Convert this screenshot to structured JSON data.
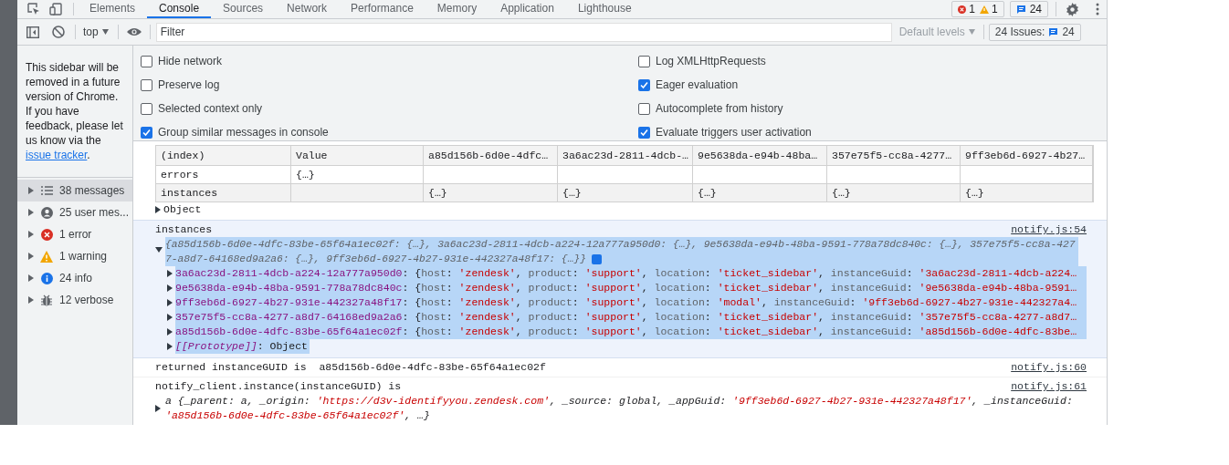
{
  "tabs": [
    {
      "label": "Elements",
      "selected": false
    },
    {
      "label": "Console",
      "selected": true
    },
    {
      "label": "Sources",
      "selected": false
    },
    {
      "label": "Network",
      "selected": false
    },
    {
      "label": "Performance",
      "selected": false
    },
    {
      "label": "Memory",
      "selected": false
    },
    {
      "label": "Application",
      "selected": false
    },
    {
      "label": "Lighthouse",
      "selected": false
    }
  ],
  "counters": {
    "errors": "1",
    "warnings": "1",
    "issues": "24"
  },
  "toolbar": {
    "context": "top",
    "filter_placeholder": "Filter",
    "levels": "Default levels",
    "issues_label": "24 Issues:",
    "issues_count": "24"
  },
  "settings": {
    "left": [
      {
        "label": "Hide network",
        "checked": false
      },
      {
        "label": "Preserve log",
        "checked": false
      },
      {
        "label": "Selected context only",
        "checked": false
      },
      {
        "label": "Group similar messages in console",
        "checked": true
      }
    ],
    "right": [
      {
        "label": "Log XMLHttpRequests",
        "checked": false
      },
      {
        "label": "Eager evaluation",
        "checked": true
      },
      {
        "label": "Autocomplete from history",
        "checked": false
      },
      {
        "label": "Evaluate triggers user activation",
        "checked": true
      }
    ]
  },
  "sidebar": {
    "note": "This sidebar will be removed in a future version of Chrome. If you have feedback, please let us know via the",
    "link": "issue tracker",
    "note_end": ".",
    "items": [
      {
        "kind": "messages",
        "label": "38 messages",
        "selected": true
      },
      {
        "kind": "user",
        "label": "25 user mes...",
        "selected": false
      },
      {
        "kind": "error",
        "label": "1 error",
        "selected": false
      },
      {
        "kind": "warning",
        "label": "1 warning",
        "selected": false
      },
      {
        "kind": "info",
        "label": "24 info",
        "selected": false
      },
      {
        "kind": "verbose",
        "label": "12 verbose",
        "selected": false
      }
    ]
  },
  "table": {
    "columns": [
      "(index)",
      "Value",
      "a85d156b-6d0e-4dfc…",
      "3a6ac23d-2811-4dcb-…",
      "9e5638da-e94b-48ba…",
      "357e75f5-cc8a-4277…",
      "9ff3eb6d-6927-4b27…"
    ],
    "rows": [
      [
        "errors",
        "{…}",
        "",
        "",
        "",
        "",
        ""
      ],
      [
        "instances",
        "",
        "{…}",
        "{…}",
        "{…}",
        "{…}",
        "{…}"
      ]
    ],
    "footer": "Object"
  },
  "instances_message": {
    "title": "instances",
    "source": "notify.js:54",
    "expanded": true,
    "summary": "{a85d156b-6d0e-4dfc-83be-65f64a1ec02f: {…}, 3a6ac23d-2811-4dcb-a224-12a777a950d0: {…}, 9e5638da-e94b-48ba-9591-778a78dc840c: {…}, 357e75f5-cc8a-4277-a8d7-64168ed9a2a6: {…}, 9ff3eb6d-6927-4b27-931e-442327a48f17: {…}}",
    "entries": [
      [
        {
          "kind": "key",
          "text": "3a6ac23d-2811-4dcb-a224-12a777a950d0"
        },
        {
          "kind": "punct",
          "text": ": {"
        },
        {
          "kind": "name",
          "text": "host"
        },
        {
          "kind": "punct",
          "text": ": "
        },
        {
          "kind": "string",
          "text": "'zendesk'"
        },
        {
          "kind": "punct",
          "text": ", "
        },
        {
          "kind": "name",
          "text": "product"
        },
        {
          "kind": "punct",
          "text": ": "
        },
        {
          "kind": "string",
          "text": "'support'"
        },
        {
          "kind": "punct",
          "text": ", "
        },
        {
          "kind": "name",
          "text": "location"
        },
        {
          "kind": "punct",
          "text": ": "
        },
        {
          "kind": "string",
          "text": "'ticket_sidebar'"
        },
        {
          "kind": "punct",
          "text": ", "
        },
        {
          "kind": "name",
          "text": "instanceGuid"
        },
        {
          "kind": "punct",
          "text": ": "
        },
        {
          "kind": "string",
          "text": "'3a6ac23d-2811-4dcb-a224…"
        }
      ],
      [
        {
          "kind": "key",
          "text": "9e5638da-e94b-48ba-9591-778a78dc840c"
        },
        {
          "kind": "punct",
          "text": ": {"
        },
        {
          "kind": "name",
          "text": "host"
        },
        {
          "kind": "punct",
          "text": ": "
        },
        {
          "kind": "string",
          "text": "'zendesk'"
        },
        {
          "kind": "punct",
          "text": ", "
        },
        {
          "kind": "name",
          "text": "product"
        },
        {
          "kind": "punct",
          "text": ": "
        },
        {
          "kind": "string",
          "text": "'support'"
        },
        {
          "kind": "punct",
          "text": ", "
        },
        {
          "kind": "name",
          "text": "location"
        },
        {
          "kind": "punct",
          "text": ": "
        },
        {
          "kind": "string",
          "text": "'ticket_sidebar'"
        },
        {
          "kind": "punct",
          "text": ", "
        },
        {
          "kind": "name",
          "text": "instanceGuid"
        },
        {
          "kind": "punct",
          "text": ": "
        },
        {
          "kind": "string",
          "text": "'9e5638da-e94b-48ba-9591…"
        }
      ],
      [
        {
          "kind": "key",
          "text": "9ff3eb6d-6927-4b27-931e-442327a48f17"
        },
        {
          "kind": "punct",
          "text": ": {"
        },
        {
          "kind": "name",
          "text": "host"
        },
        {
          "kind": "punct",
          "text": ": "
        },
        {
          "kind": "string",
          "text": "'zendesk'"
        },
        {
          "kind": "punct",
          "text": ", "
        },
        {
          "kind": "name",
          "text": "product"
        },
        {
          "kind": "punct",
          "text": ": "
        },
        {
          "kind": "string",
          "text": "'support'"
        },
        {
          "kind": "punct",
          "text": ", "
        },
        {
          "kind": "name",
          "text": "location"
        },
        {
          "kind": "punct",
          "text": ": "
        },
        {
          "kind": "string",
          "text": "'modal'"
        },
        {
          "kind": "punct",
          "text": ", "
        },
        {
          "kind": "name",
          "text": "instanceGuid"
        },
        {
          "kind": "punct",
          "text": ": "
        },
        {
          "kind": "string",
          "text": "'9ff3eb6d-6927-4b27-931e-442327a4…"
        }
      ],
      [
        {
          "kind": "key",
          "text": "357e75f5-cc8a-4277-a8d7-64168ed9a2a6"
        },
        {
          "kind": "punct",
          "text": ": {"
        },
        {
          "kind": "name",
          "text": "host"
        },
        {
          "kind": "punct",
          "text": ": "
        },
        {
          "kind": "string",
          "text": "'zendesk'"
        },
        {
          "kind": "punct",
          "text": ", "
        },
        {
          "kind": "name",
          "text": "product"
        },
        {
          "kind": "punct",
          "text": ": "
        },
        {
          "kind": "string",
          "text": "'support'"
        },
        {
          "kind": "punct",
          "text": ", "
        },
        {
          "kind": "name",
          "text": "location"
        },
        {
          "kind": "punct",
          "text": ": "
        },
        {
          "kind": "string",
          "text": "'ticket_sidebar'"
        },
        {
          "kind": "punct",
          "text": ", "
        },
        {
          "kind": "name",
          "text": "instanceGuid"
        },
        {
          "kind": "punct",
          "text": ": "
        },
        {
          "kind": "string",
          "text": "'357e75f5-cc8a-4277-a8d7…"
        }
      ],
      [
        {
          "kind": "key",
          "text": "a85d156b-6d0e-4dfc-83be-65f64a1ec02f"
        },
        {
          "kind": "punct",
          "text": ": {"
        },
        {
          "kind": "name",
          "text": "host"
        },
        {
          "kind": "punct",
          "text": ": "
        },
        {
          "kind": "string",
          "text": "'zendesk'"
        },
        {
          "kind": "punct",
          "text": ", "
        },
        {
          "kind": "name",
          "text": "product"
        },
        {
          "kind": "punct",
          "text": ": "
        },
        {
          "kind": "string",
          "text": "'support'"
        },
        {
          "kind": "punct",
          "text": ", "
        },
        {
          "kind": "name",
          "text": "location"
        },
        {
          "kind": "punct",
          "text": ": "
        },
        {
          "kind": "string",
          "text": "'ticket_sidebar'"
        },
        {
          "kind": "punct",
          "text": ", "
        },
        {
          "kind": "name",
          "text": "instanceGuid"
        },
        {
          "kind": "punct",
          "text": ": "
        },
        {
          "kind": "string",
          "text": "'a85d156b-6d0e-4dfc-83be…"
        }
      ],
      [
        {
          "kind": "meta",
          "text": "[[Prototype]]"
        },
        {
          "kind": "punct",
          "text": ": Object"
        }
      ]
    ]
  },
  "returned_message": {
    "text": "returned instanceGUID is  a85d156b-6d0e-4dfc-83be-65f64a1ec02f",
    "source": "notify.js:60"
  },
  "client_message": {
    "text": "notify_client.instance(instanceGUID) is",
    "source": "notify.js:61",
    "preview": [
      {
        "kind": "plain",
        "text": "a {_parent: a, _origin: "
      },
      {
        "kind": "string",
        "text": "'https://d3v-identifyyou.zendesk.com'"
      },
      {
        "kind": "plain",
        "text": ", _source: global, _appGuid: "
      },
      {
        "kind": "string",
        "text": "'9ff3eb6d-6927-4b27-931e-442327a48f17'"
      },
      {
        "kind": "plain",
        "text": ", _instanceGuid: "
      },
      {
        "kind": "string",
        "text": "'a85d156b-6d0e-4dfc-83be-65f64a1ec02f'"
      },
      {
        "kind": "plain",
        "text": ", …}"
      }
    ]
  }
}
